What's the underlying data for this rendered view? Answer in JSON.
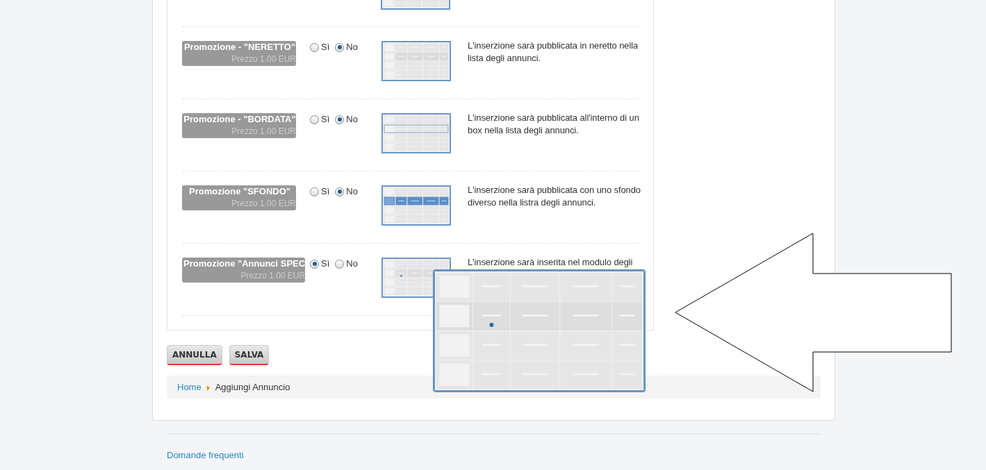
{
  "previous_option": {
    "kind": "plain"
  },
  "options": [
    {
      "title": "Promozione - \"NERETTO\"",
      "price": "Prezzo 1.00 EUR",
      "kind": "bold",
      "choices": [
        {
          "label": "Sì",
          "selected": false
        },
        {
          "label": "No",
          "selected": true
        }
      ],
      "description": "L'inserzione sarà pubblicata in neretto nella lista degli annunci."
    },
    {
      "title": "Promozione - \"BORDATA\"",
      "price": "Prezzo 1.00 EUR",
      "kind": "border",
      "choices": [
        {
          "label": "Sì",
          "selected": false
        },
        {
          "label": "No",
          "selected": true
        }
      ],
      "description": "L'inserzione sarà pubblicata all'interno di un box nella lista degli annunci."
    },
    {
      "title": "Promozione \"SFONDO\"",
      "price": "Prezzo 1.00 EUR",
      "kind": "background",
      "choices": [
        {
          "label": "Sì",
          "selected": false
        },
        {
          "label": "No",
          "selected": true
        }
      ],
      "description": "L'inserzione sarà pubblicata con uno sfondo diverso nella listra degli annunci."
    },
    {
      "title": "Promozione \"Annunci SPEC",
      "price": "Prezzo 1.00 EUR",
      "kind": "special",
      "choices": [
        {
          "label": "Sì",
          "selected": true
        },
        {
          "label": "No",
          "selected": false
        }
      ],
      "description": "L'inserzione sarà inserita nel modulo degli"
    }
  ],
  "preview_popup": {
    "kind": "special"
  },
  "buttons": [
    "ANNULLA",
    "SALVA"
  ],
  "breadcrumb": [
    {
      "label": "Home",
      "kind": "link"
    },
    {
      "label": "Aggiungi Annuncio",
      "kind": "current"
    }
  ],
  "footer_links": [
    "Domande frequenti"
  ]
}
